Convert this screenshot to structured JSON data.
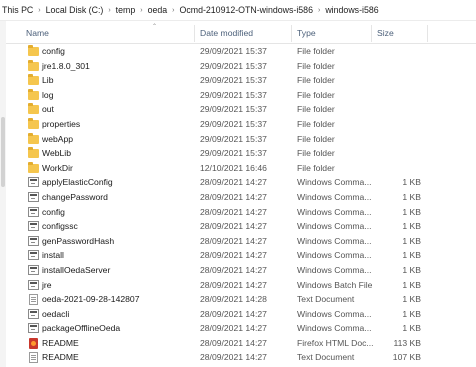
{
  "breadcrumb": [
    "This PC",
    "Local Disk (C:)",
    "temp",
    "oeda",
    "Ocmd-210912-OTN-windows-i586",
    "windows-i586"
  ],
  "columns": {
    "name": "Name",
    "date": "Date modified",
    "type": "Type",
    "size": "Size"
  },
  "files": [
    {
      "name": "config",
      "date": "29/09/2021 15:37",
      "type": "File folder",
      "size": "",
      "icon": "folder"
    },
    {
      "name": "jre1.8.0_301",
      "date": "29/09/2021 15:37",
      "type": "File folder",
      "size": "",
      "icon": "folder"
    },
    {
      "name": "Lib",
      "date": "29/09/2021 15:37",
      "type": "File folder",
      "size": "",
      "icon": "folder"
    },
    {
      "name": "log",
      "date": "29/09/2021 15:37",
      "type": "File folder",
      "size": "",
      "icon": "folder"
    },
    {
      "name": "out",
      "date": "29/09/2021 15:37",
      "type": "File folder",
      "size": "",
      "icon": "folder"
    },
    {
      "name": "properties",
      "date": "29/09/2021 15:37",
      "type": "File folder",
      "size": "",
      "icon": "folder"
    },
    {
      "name": "webApp",
      "date": "29/09/2021 15:37",
      "type": "File folder",
      "size": "",
      "icon": "folder"
    },
    {
      "name": "WebLib",
      "date": "29/09/2021 15:37",
      "type": "File folder",
      "size": "",
      "icon": "folder"
    },
    {
      "name": "WorkDir",
      "date": "12/10/2021 16:46",
      "type": "File folder",
      "size": "",
      "icon": "folder"
    },
    {
      "name": "applyElasticConfig",
      "date": "28/09/2021 14:27",
      "type": "Windows Comma...",
      "size": "1 KB",
      "icon": "cmd"
    },
    {
      "name": "changePassword",
      "date": "28/09/2021 14:27",
      "type": "Windows Comma...",
      "size": "1 KB",
      "icon": "cmd"
    },
    {
      "name": "config",
      "date": "28/09/2021 14:27",
      "type": "Windows Comma...",
      "size": "1 KB",
      "icon": "cmd"
    },
    {
      "name": "configssc",
      "date": "28/09/2021 14:27",
      "type": "Windows Comma...",
      "size": "1 KB",
      "icon": "cmd"
    },
    {
      "name": "genPasswordHash",
      "date": "28/09/2021 14:27",
      "type": "Windows Comma...",
      "size": "1 KB",
      "icon": "cmd"
    },
    {
      "name": "install",
      "date": "28/09/2021 14:27",
      "type": "Windows Comma...",
      "size": "1 KB",
      "icon": "cmd"
    },
    {
      "name": "installOedaServer",
      "date": "28/09/2021 14:27",
      "type": "Windows Comma...",
      "size": "1 KB",
      "icon": "cmd"
    },
    {
      "name": "jre",
      "date": "28/09/2021 14:27",
      "type": "Windows Batch File",
      "size": "1 KB",
      "icon": "cmd"
    },
    {
      "name": "oeda-2021-09-28-142807",
      "date": "28/09/2021 14:28",
      "type": "Text Document",
      "size": "1 KB",
      "icon": "text"
    },
    {
      "name": "oedacli",
      "date": "28/09/2021 14:27",
      "type": "Windows Comma...",
      "size": "1 KB",
      "icon": "cmd"
    },
    {
      "name": "packageOfflineOeda",
      "date": "28/09/2021 14:27",
      "type": "Windows Comma...",
      "size": "1 KB",
      "icon": "cmd"
    },
    {
      "name": "README",
      "date": "28/09/2021 14:27",
      "type": "Firefox HTML Doc...",
      "size": "113 KB",
      "icon": "html"
    },
    {
      "name": "README",
      "date": "28/09/2021 14:27",
      "type": "Text Document",
      "size": "107 KB",
      "icon": "text"
    }
  ]
}
